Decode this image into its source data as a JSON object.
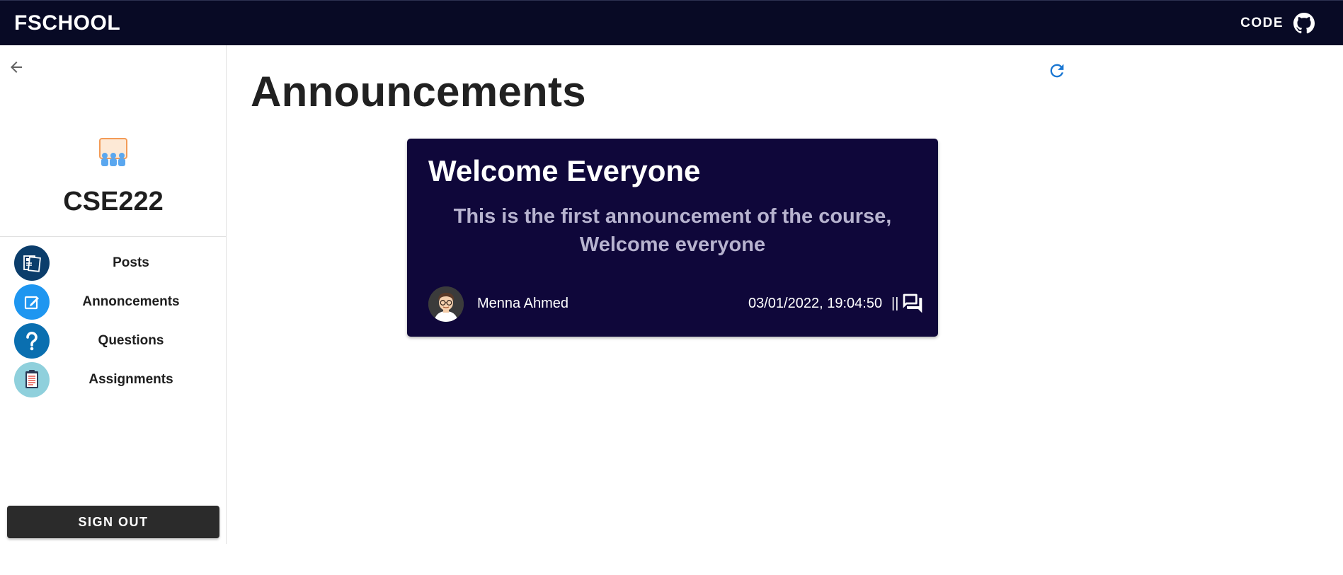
{
  "appbar": {
    "brand": "FSCHOOL",
    "code_label": "CODE",
    "github_icon": "github-icon"
  },
  "sidebar": {
    "back_icon": "arrow-left-icon",
    "course_icon": "classroom-icon",
    "course_name": "CSE222",
    "items": [
      {
        "label": "Posts",
        "icon": "posts-icon"
      },
      {
        "label": "Annoncements",
        "icon": "announcement-edit-icon"
      },
      {
        "label": "Questions",
        "icon": "question-icon"
      },
      {
        "label": "Assignments",
        "icon": "clipboard-icon"
      }
    ],
    "signout_label": "SIGN OUT"
  },
  "main": {
    "title": "Announcements",
    "refresh_icon": "refresh-icon",
    "announcement": {
      "title": "Welcome Everyone",
      "body": "This is the first announcement of the course, Welcome everyone",
      "author": "Menna Ahmed",
      "datetime": "03/01/2022, 19:04:50",
      "separator": "||",
      "comment_icon": "comments-icon"
    }
  },
  "colors": {
    "appbar_bg": "#080a25",
    "card_bg": "#0f073a",
    "card_body_text": "#b7b3cf",
    "accent_blue": "#1976d2",
    "signout_bg": "#2b2b2b"
  }
}
